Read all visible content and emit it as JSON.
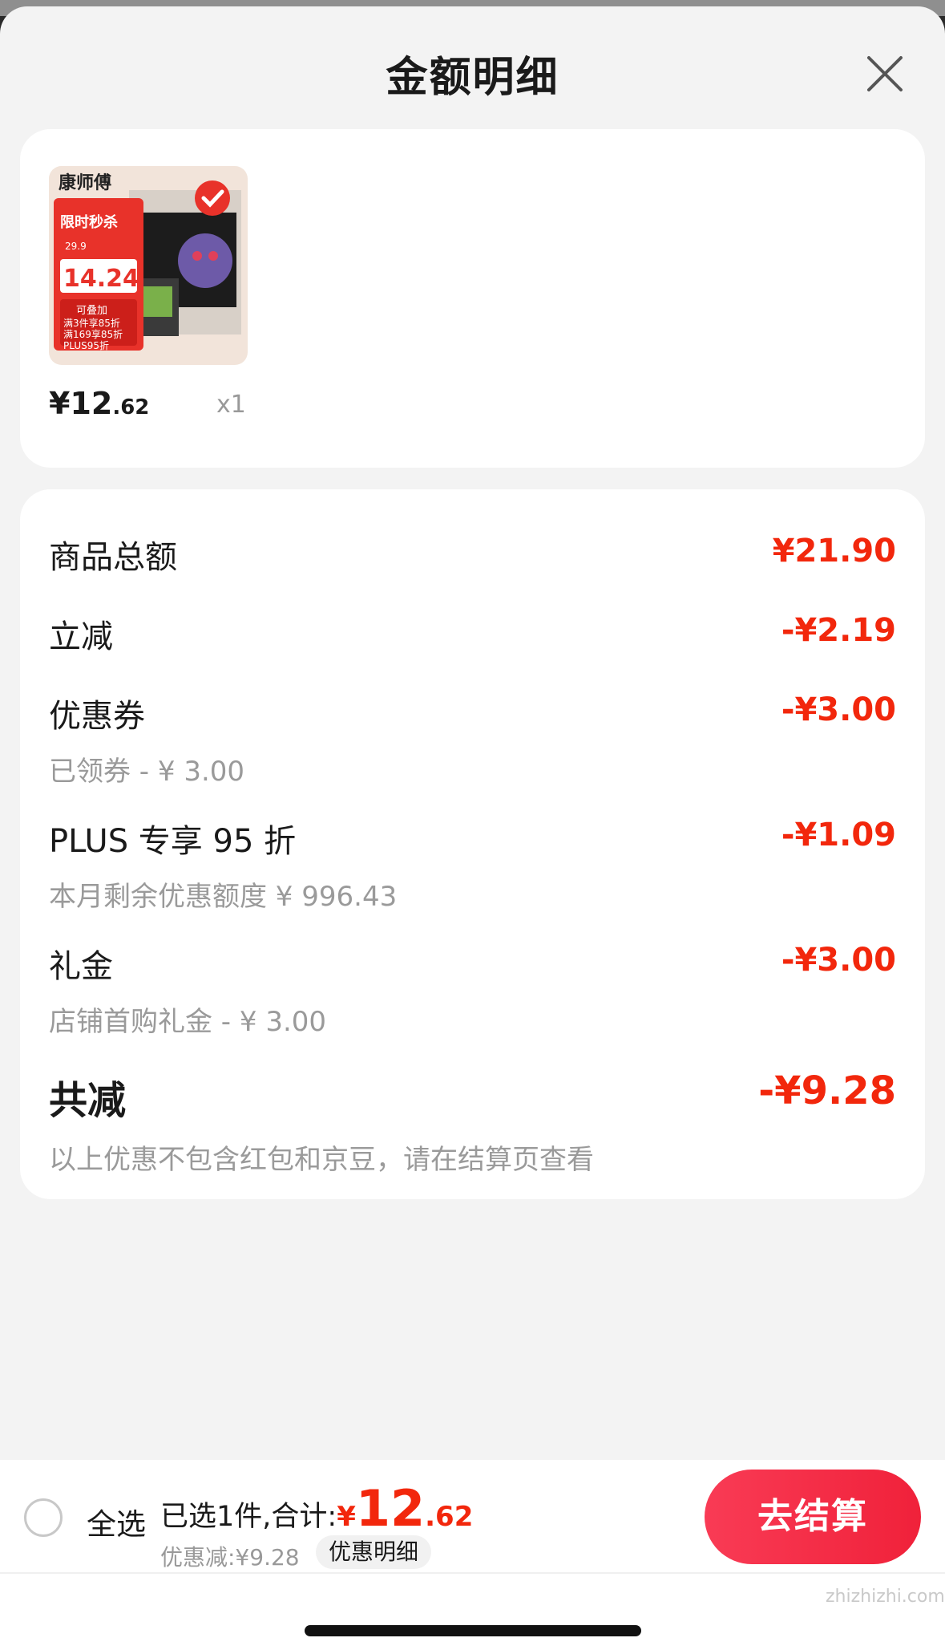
{
  "sheet": {
    "title": "金额明细"
  },
  "product": {
    "image": {
      "brand": "康师傅",
      "promo_tag": "限时秒杀",
      "orig_price": "29.9",
      "promo_price": "14.24",
      "stack_line1": "可叠加",
      "stack_line2": "满3件享85折",
      "stack_line3": "满169享85折",
      "stack_line4": "PLUS95折"
    },
    "price_int": "¥12",
    "price_dec": ".62",
    "qty": "x1"
  },
  "details": {
    "rows": [
      {
        "label": "商品总额",
        "value": "¥21.90",
        "sub": ""
      },
      {
        "label": "立减",
        "value": "-¥2.19",
        "sub": ""
      },
      {
        "label": "优惠券",
        "value": "-¥3.00",
        "sub": "已领券 - ¥ 3.00"
      },
      {
        "label": "PLUS 专享 95 折",
        "value": "-¥1.09",
        "sub": "本月剩余优惠额度 ¥ 996.43"
      },
      {
        "label": "礼金",
        "value": "-¥3.00",
        "sub": "店铺首购礼金 - ¥ 3.00"
      }
    ],
    "total": {
      "label": "共减",
      "value": "-¥9.28",
      "note": "以上优惠不包含红包和京豆，请在结算页查看"
    }
  },
  "bottom": {
    "select_all": "全选",
    "summary_prefix": "已选1件,合计:",
    "total_yen": "¥",
    "total_int": "12",
    "total_dec": ".62",
    "discount": "优惠减:¥9.28",
    "detail_link": "优惠明细",
    "checkout": "去结算"
  },
  "watermark": "zhizhizhi.com",
  "colors": {
    "accent_red": "#f2270c",
    "sheet_bg": "#f3f3f3"
  }
}
